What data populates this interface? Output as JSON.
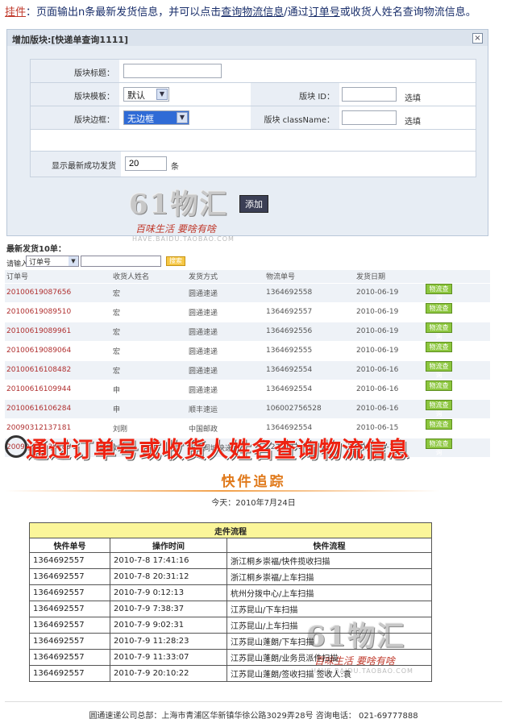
{
  "header": {
    "label": "挂件",
    "sep": "：",
    "part1": "页面输出n条最新发货信息，并可以点击",
    "link1": "查询物流信息",
    "part2": "/通过",
    "link2": "订单号",
    "part3": "或收货人姓名查询物流信息。"
  },
  "dialog": {
    "title": "增加版块:[快递单查询1111]",
    "close": "×",
    "fields": {
      "block_title_label": "版块标题：",
      "block_title_value": "",
      "template_label": "版块模板：",
      "template_value": "默认",
      "border_label": "版块边框：",
      "border_value": "无边框",
      "id_label": "版块 ID：",
      "id_value": "",
      "id_note": "选填",
      "class_label": "版块 className：",
      "class_value": "",
      "class_note": "选填",
      "count_label": "显示最新成功发货",
      "count_value": "20",
      "count_unit": "条"
    },
    "add_button": "添加"
  },
  "watermark": {
    "big": "61物汇",
    "slogan": "百味生活 要啥有啥",
    "url": "HAVE.BAIDU.TAOBAO.COM"
  },
  "list": {
    "title": "最新发货10单：",
    "search_label": "请输入:",
    "search_field": "订单号",
    "search_button": "搜索",
    "columns": [
      "订单号",
      "收货人姓名",
      "发货方式",
      "物流单号",
      "发货日期",
      ""
    ],
    "rows": [
      {
        "id": "20100619087656",
        "name": "宏",
        "method": "圆通速递",
        "tracking": "1364692558",
        "date": "2010-06-19",
        "action": "物流查询"
      },
      {
        "id": "20100619089510",
        "name": "宏",
        "method": "圆通速递",
        "tracking": "1364692557",
        "date": "2010-06-19",
        "action": "物流查询"
      },
      {
        "id": "20100619089961",
        "name": "宏",
        "method": "圆通速递",
        "tracking": "1364692556",
        "date": "2010-06-19",
        "action": "物流查询"
      },
      {
        "id": "20100619089064",
        "name": "宏",
        "method": "圆通速递",
        "tracking": "1364692555",
        "date": "2010-06-19",
        "action": "物流查询"
      },
      {
        "id": "20100616108482",
        "name": "宏",
        "method": "圆通速递",
        "tracking": "1364692554",
        "date": "2010-06-16",
        "action": "物流查询"
      },
      {
        "id": "20100616109944",
        "name": "申",
        "method": "圆通速递",
        "tracking": "1364692554",
        "date": "2010-06-16",
        "action": "物流查询"
      },
      {
        "id": "20100616106284",
        "name": "申",
        "method": "顺丰速运",
        "tracking": "106002756528",
        "date": "2010-06-16",
        "action": "物流查询"
      },
      {
        "id": "20090312137181",
        "name": "刘刚",
        "method": "中国邮政",
        "tracking": "1364692554",
        "date": "2010-06-15",
        "action": "物流查询"
      },
      {
        "id": "20090312138789",
        "name": "刘刚",
        "method": "上海同城快递",
        "tracking": "2222222",
        "date": "2009-03-12",
        "action": "物流查询"
      }
    ]
  },
  "banner": {
    "text": "通过订单号或收货人姓名查询物流信息"
  },
  "tracking": {
    "title": "快件追踪",
    "date": "今天：2010年7月24日",
    "caption": "走件流程",
    "columns": [
      "快件单号",
      "操作时间",
      "快件流程"
    ],
    "rows": [
      {
        "no": "1364692557",
        "time": "2010-7-8 17:41:16",
        "flow": "浙江桐乡崇福/快件揽收扫描"
      },
      {
        "no": "1364692557",
        "time": "2010-7-8 20:31:12",
        "flow": "浙江桐乡崇福/上车扫描"
      },
      {
        "no": "1364692557",
        "time": "2010-7-9 0:12:13",
        "flow": "杭州分拨中心/上车扫描"
      },
      {
        "no": "1364692557",
        "time": "2010-7-9 7:38:37",
        "flow": "江苏昆山/下车扫描"
      },
      {
        "no": "1364692557",
        "time": "2010-7-9 9:02:31",
        "flow": "江苏昆山/上车扫描"
      },
      {
        "no": "1364692557",
        "time": "2010-7-9 11:28:23",
        "flow": "江苏昆山蓬朗/下车扫描"
      },
      {
        "no": "1364692557",
        "time": "2010-7-9 11:33:07",
        "flow": "江苏昆山蓬朗/业务员派件扫描"
      },
      {
        "no": "1364692557",
        "time": "2010-7-9 20:10:22",
        "flow": "江苏昆山蓬朗/签收扫描 签收人:袁"
      }
    ],
    "footer": "圆通速递公司总部：上海市青浦区华新镇华徐公路3029弄28号  咨询电话： 021-69777888"
  }
}
